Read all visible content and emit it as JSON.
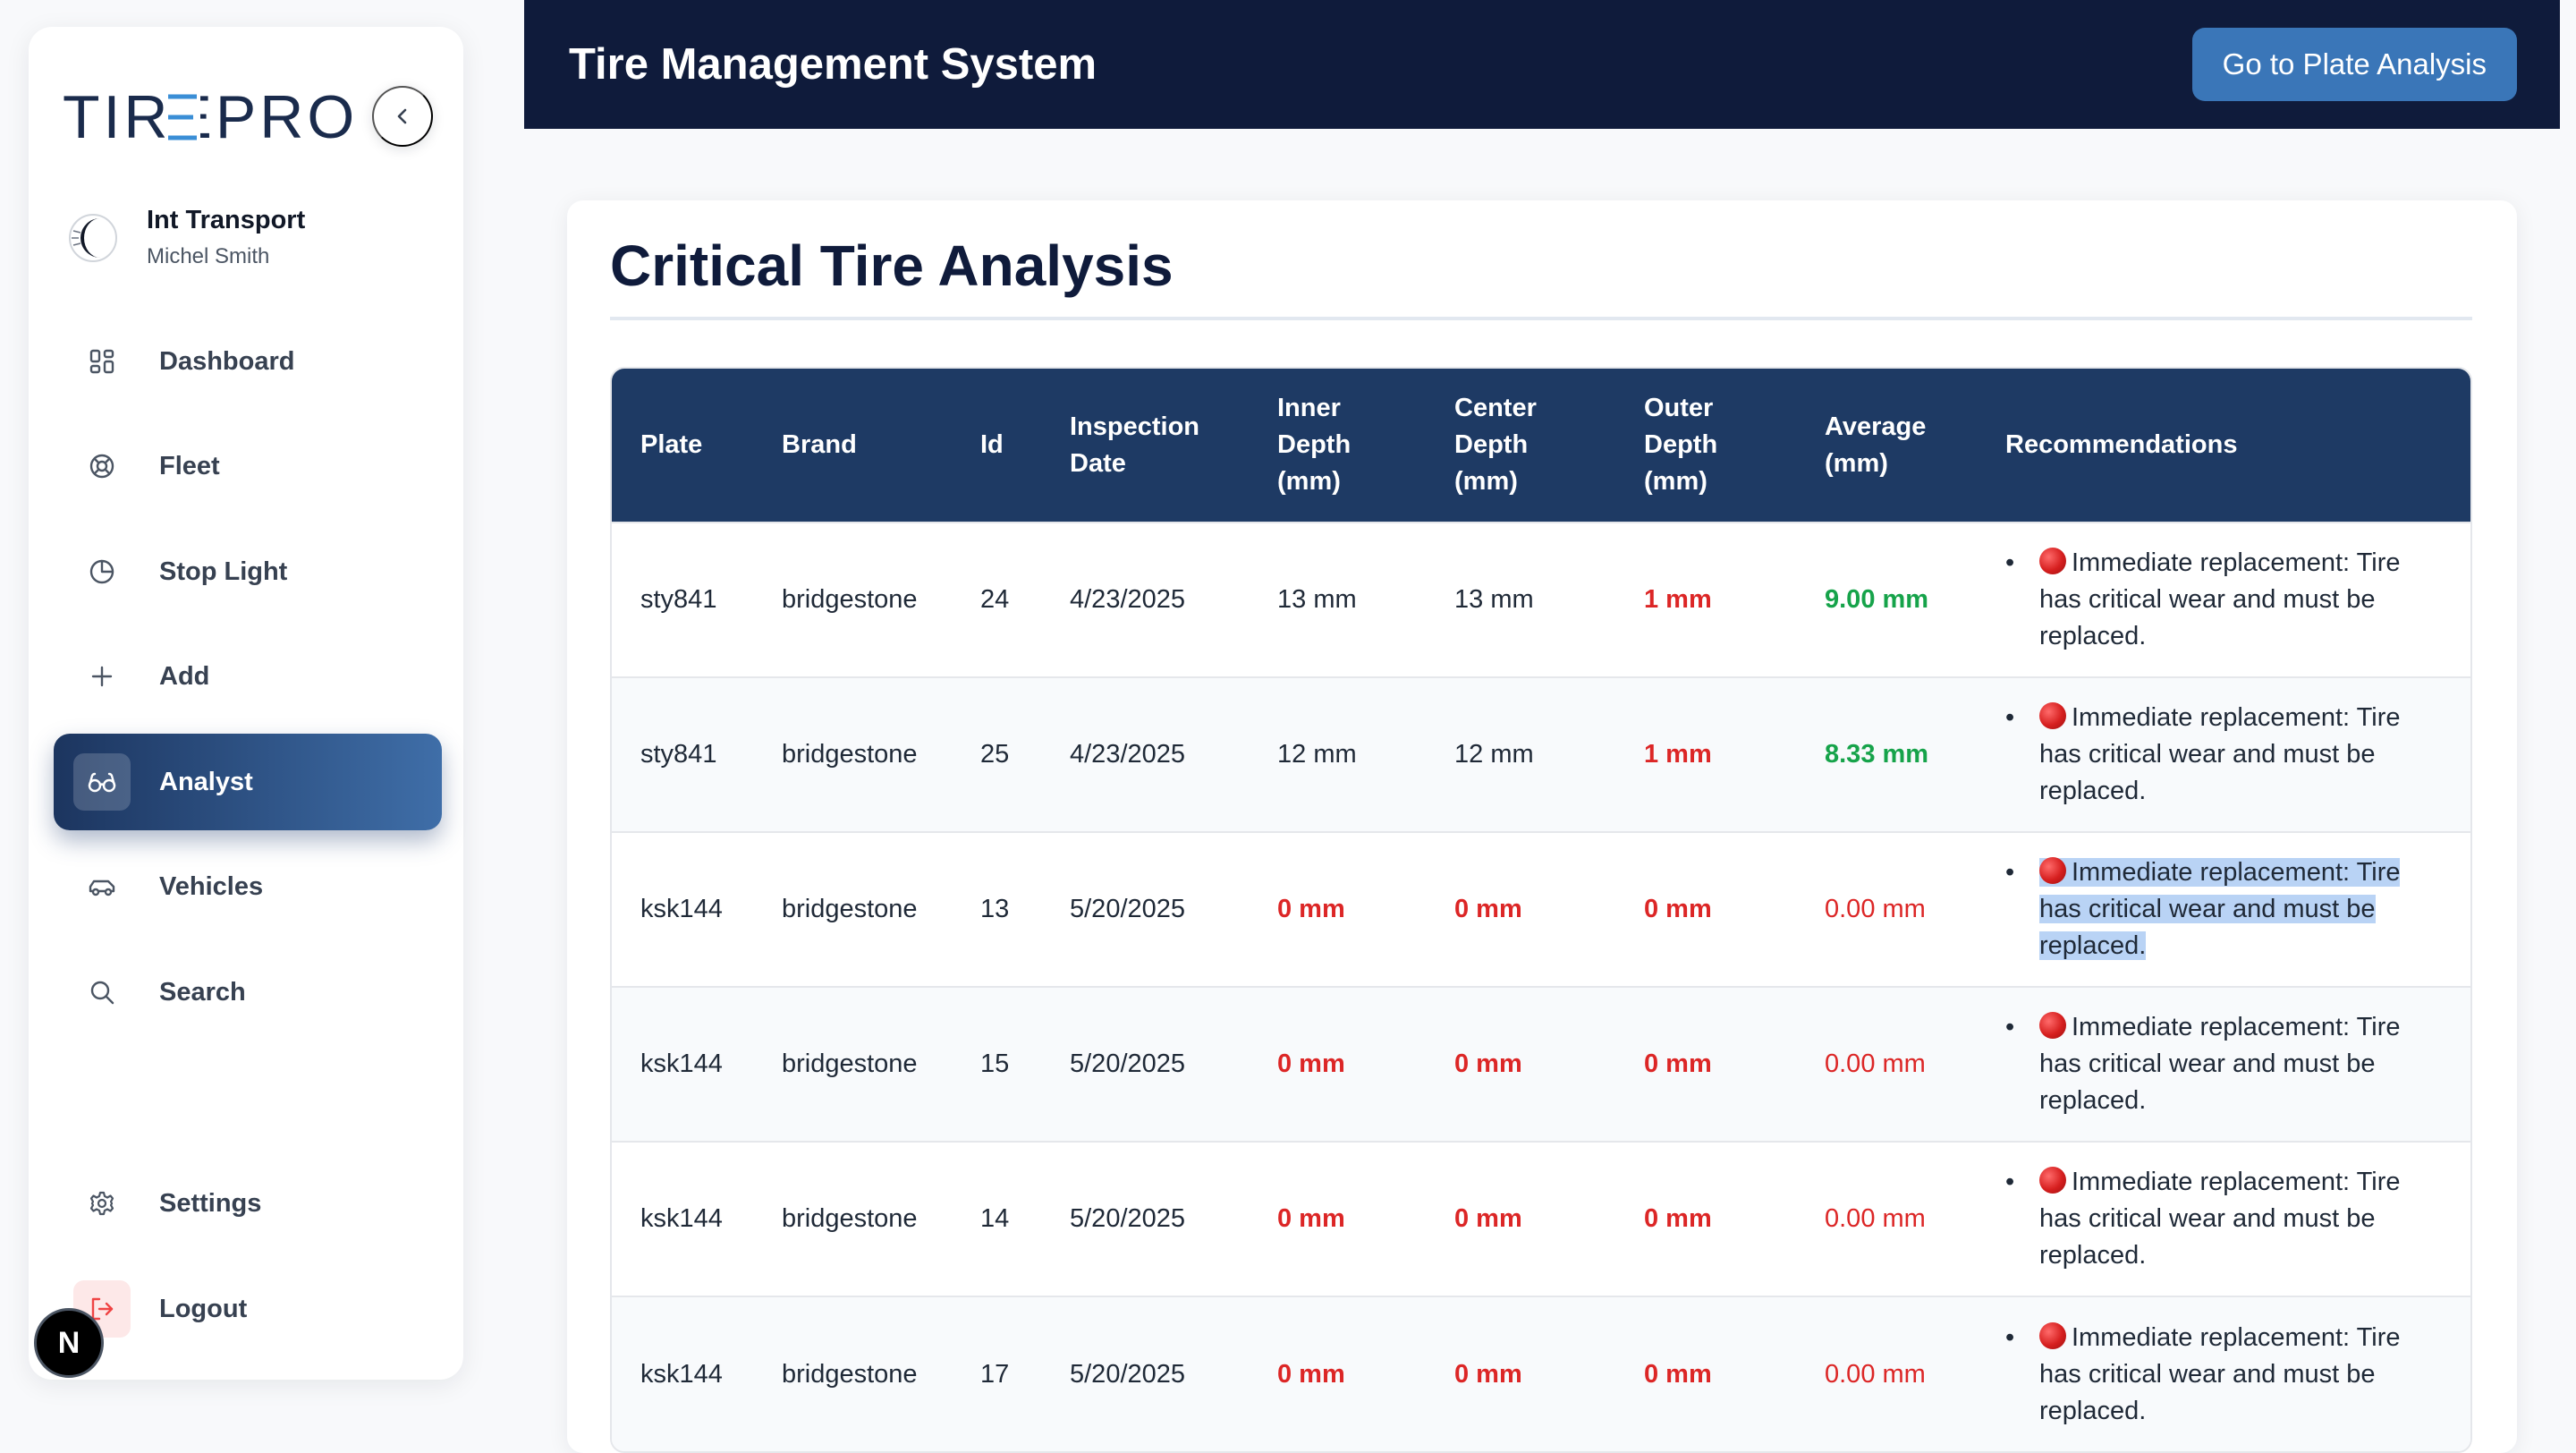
{
  "brand": {
    "logo_text": "TIREPRO"
  },
  "company": {
    "name": "Int Transport",
    "user": "Michel Smith"
  },
  "nav": {
    "items": [
      {
        "label": "Dashboard",
        "icon": "dashboard-grid-icon"
      },
      {
        "label": "Fleet",
        "icon": "tire-ring-icon"
      },
      {
        "label": "Stop Light",
        "icon": "pie-chart-icon"
      },
      {
        "label": "Add",
        "icon": "plus-icon"
      },
      {
        "label": "Analyst",
        "icon": "glasses-icon",
        "active": true
      },
      {
        "label": "Vehicles",
        "icon": "car-icon"
      },
      {
        "label": "Search",
        "icon": "search-icon"
      }
    ],
    "settings": {
      "label": "Settings",
      "icon": "gear-icon"
    },
    "logout": {
      "label": "Logout",
      "icon": "logout-icon"
    }
  },
  "dev_badge": {
    "text": "N"
  },
  "header": {
    "title": "Tire Management System",
    "plate_button": "Go to Plate Analysis"
  },
  "main": {
    "title": "Critical Tire Analysis",
    "table": {
      "columns": [
        [
          "Plate"
        ],
        [
          "Brand"
        ],
        [
          "Id"
        ],
        [
          "Inspection",
          "Date"
        ],
        [
          "Inner",
          "Depth",
          "(mm)"
        ],
        [
          "Center",
          "Depth",
          "(mm)"
        ],
        [
          "Outer",
          "Depth",
          "(mm)"
        ],
        [
          "Average",
          "(mm)"
        ],
        [
          "Recommendations"
        ]
      ],
      "rows": [
        {
          "plate": "sty841",
          "brand": "bridgestone",
          "id": "24",
          "date": "4/23/2025",
          "inner": "13 mm",
          "center": "13 mm",
          "outer": "1 mm",
          "average": "9.00 mm",
          "recommendation": [
            "Immediate replacement: Tire",
            "has critical wear and must be",
            "replaced."
          ]
        },
        {
          "plate": "sty841",
          "brand": "bridgestone",
          "id": "25",
          "date": "4/23/2025",
          "inner": "12 mm",
          "center": "12 mm",
          "outer": "1 mm",
          "average": "8.33 mm",
          "recommendation": [
            "Immediate replacement: Tire",
            "has critical wear and must be",
            "replaced."
          ]
        },
        {
          "plate": "ksk144",
          "brand": "bridgestone",
          "id": "13",
          "date": "5/20/2025",
          "inner": "0 mm",
          "center": "0 mm",
          "outer": "0 mm",
          "average": "0.00 mm",
          "recommendation": [
            "Immediate replacement: Tire",
            "has critical wear and must be",
            "replaced."
          ]
        },
        {
          "plate": "ksk144",
          "brand": "bridgestone",
          "id": "15",
          "date": "5/20/2025",
          "inner": "0 mm",
          "center": "0 mm",
          "outer": "0 mm",
          "average": "0.00 mm",
          "recommendation": [
            "Immediate replacement: Tire",
            "has critical wear and must be",
            "replaced."
          ]
        },
        {
          "plate": "ksk144",
          "brand": "bridgestone",
          "id": "14",
          "date": "5/20/2025",
          "inner": "0 mm",
          "center": "0 mm",
          "outer": "0 mm",
          "average": "0.00 mm",
          "recommendation": [
            "Immediate replacement: Tire",
            "has critical wear and must be",
            "replaced."
          ]
        },
        {
          "plate": "ksk144",
          "brand": "bridgestone",
          "id": "17",
          "date": "5/20/2025",
          "inner": "0 mm",
          "center": "0 mm",
          "outer": "0 mm",
          "average": "0.00 mm",
          "recommendation": [
            "Immediate replacement: Tire",
            "has critical wear and must be",
            "replaced."
          ]
        }
      ]
    }
  },
  "colors": {
    "header_bg": "#0f1b3b",
    "table_header_bg": "#1e3a64",
    "accent_button": "#3a76b8",
    "critical": "#dc2626",
    "ok": "#16a34a",
    "selection": "#b9d3f5"
  }
}
